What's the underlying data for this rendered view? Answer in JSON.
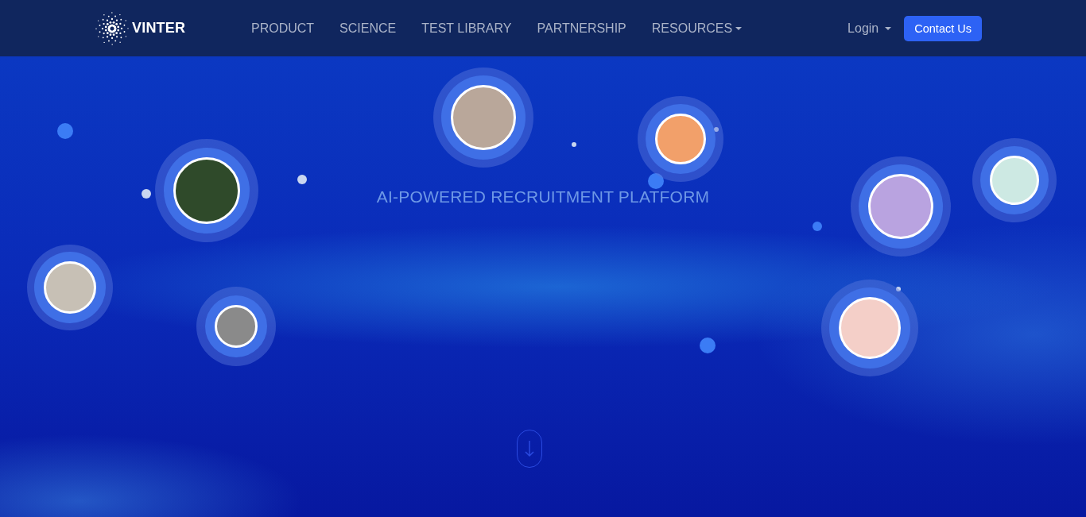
{
  "brand": {
    "name": "VINTER"
  },
  "nav": {
    "items": [
      {
        "label": "PRODUCT",
        "dropdown": false
      },
      {
        "label": "SCIENCE",
        "dropdown": false
      },
      {
        "label": "TEST LIBRARY",
        "dropdown": false
      },
      {
        "label": "PARTNERSHIP",
        "dropdown": false
      },
      {
        "label": "RESOURCES",
        "dropdown": true
      }
    ],
    "login": {
      "label": "Login",
      "dropdown": true
    },
    "cta": "Contact Us"
  },
  "hero": {
    "tagline": "AI-POWERED RECRUITMENT PLATFORM"
  }
}
